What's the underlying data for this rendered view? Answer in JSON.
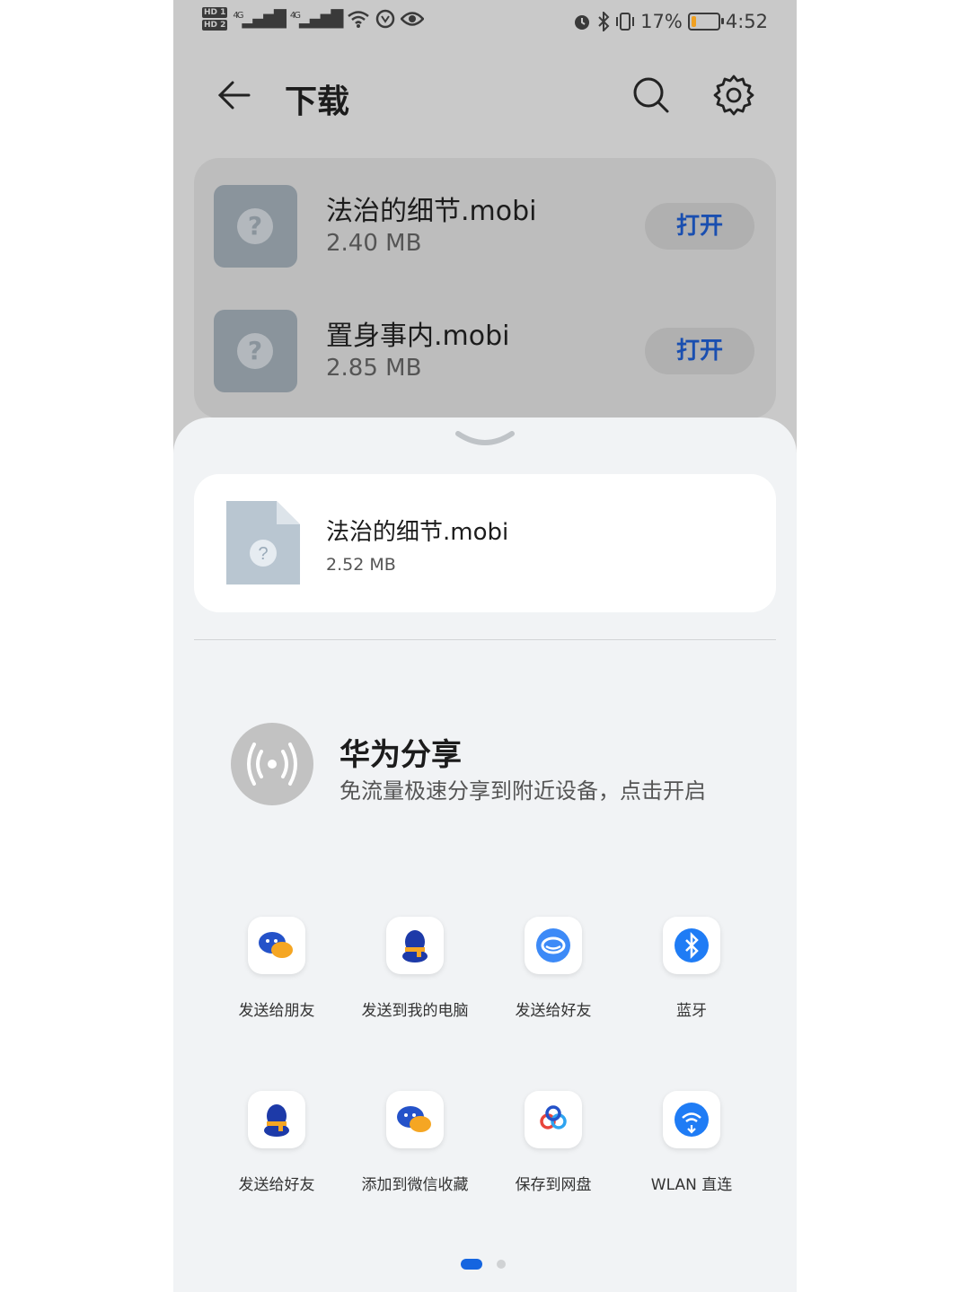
{
  "status_bar": {
    "hd1": "HD 1",
    "hd2": "HD 2",
    "signal1": "4G",
    "signal2": "4G",
    "battery": "17%",
    "time": "4:52",
    "battery_level": 0.17,
    "battery_color": "#f0a020"
  },
  "header": {
    "title": "下载",
    "icons": [
      "back-arrow-icon",
      "search-icon",
      "gear-icon"
    ]
  },
  "files": [
    {
      "name": "法治的细节.mobi",
      "size": "2.40 MB",
      "action": "打开"
    },
    {
      "name": "置身事内.mobi",
      "size": "2.85 MB",
      "action": "打开"
    }
  ],
  "share_sheet": {
    "preview": {
      "name": "法治的细节.mobi",
      "size": "2.52 MB"
    },
    "huawei_share": {
      "title": "华为分享",
      "subtitle": "免流量极速分享到附近设备，点击开启"
    },
    "apps": [
      {
        "label": "发送给朋友",
        "icon": "wechat-icon"
      },
      {
        "label": "发送到我的电脑",
        "icon": "qq-icon"
      },
      {
        "label": "发送给好友",
        "icon": "tim-icon"
      },
      {
        "label": "蓝牙",
        "icon": "bluetooth-icon"
      },
      {
        "label": "发送给好友",
        "icon": "qq-icon"
      },
      {
        "label": "添加到微信收藏",
        "icon": "wechat-icon"
      },
      {
        "label": "保存到网盘",
        "icon": "baidu-netdisk-icon"
      },
      {
        "label": "WLAN 直连",
        "icon": "wifi-direct-icon"
      }
    ],
    "page_indicator": {
      "pages": 2,
      "current": 1
    }
  },
  "colors": {
    "accent": "#1565e0",
    "open_button_text": "#1a4fb0",
    "dim_background": "#c9c9c9"
  }
}
